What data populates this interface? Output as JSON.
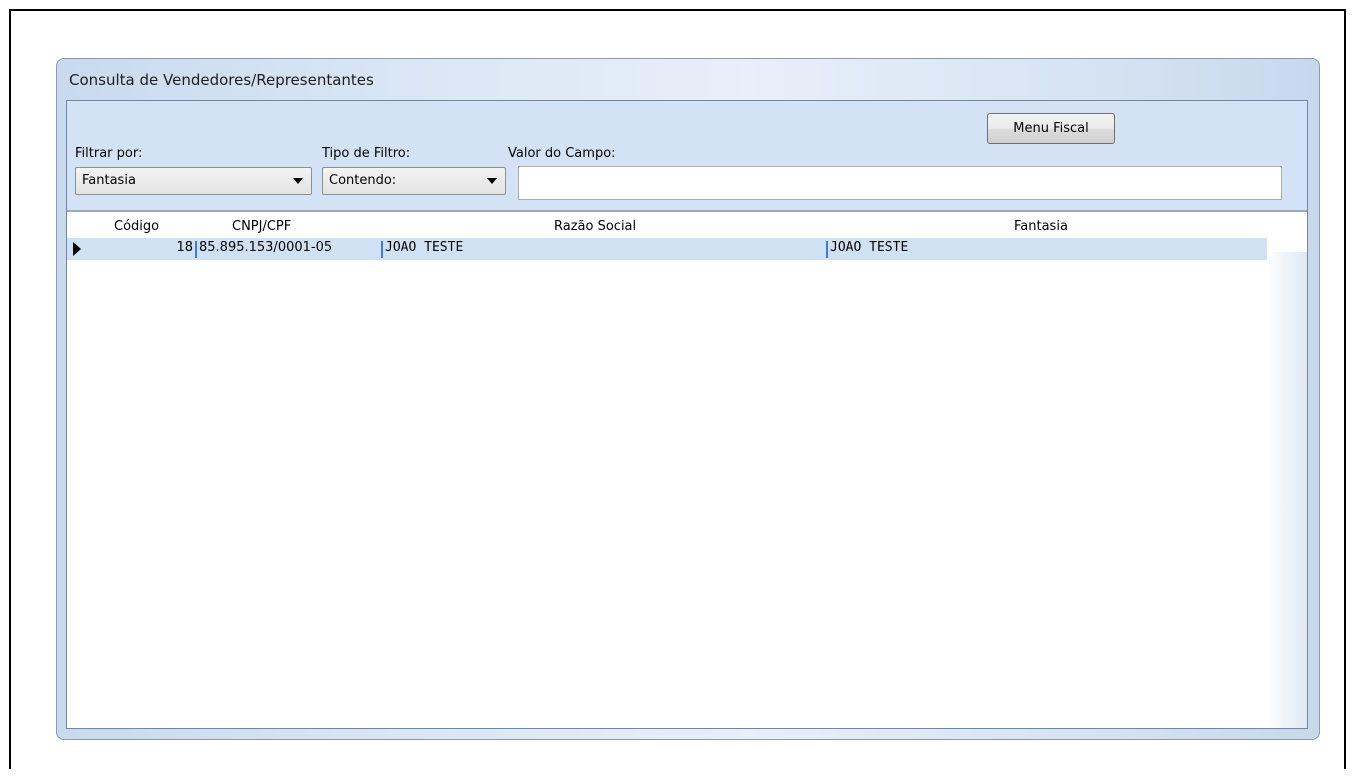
{
  "window": {
    "title": "Consulta de Vendedores/Representantes"
  },
  "filters": {
    "filter_by_label": "Filtrar por:",
    "filter_by_value": "Fantasia",
    "filter_type_label": "Tipo de Filtro:",
    "filter_type_value": "Contendo:",
    "field_value_label": "Valor do Campo:",
    "field_value": "",
    "menu_fiscal_label": "Menu Fiscal"
  },
  "grid": {
    "columns": [
      "Código",
      "CNPJ/CPF",
      "Razão Social",
      "Fantasia"
    ],
    "rows": [
      {
        "codigo": "18",
        "cnpj_cpf": "85.895.153/0001-05",
        "razao_social": "JOAO TESTE",
        "fantasia": "JOAO TESTE"
      }
    ]
  },
  "colors": {
    "filter_panel_bg": "#d4e2f6",
    "selected_row_bg": "#d1e1f4",
    "column_separator": "#3c7fd6"
  }
}
